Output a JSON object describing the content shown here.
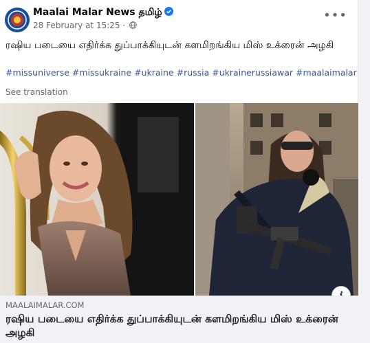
{
  "post": {
    "page_name": "Maalai Malar News தமிழ்",
    "timestamp": "28 February at 15:25",
    "separator": " · ",
    "more_label": "•••",
    "text": "ரஷிய படையை எதிர்க்க துப்பாக்கியுடன் களமிறங்கிய மிஸ் உக்ரைன் அழகி",
    "hashtags": [
      "#missuniverse",
      "#missukraine",
      "#ukraine",
      "#russia",
      "#ukrainerussiawar",
      "#maalaimalar"
    ],
    "see_translation": "See translation"
  },
  "link_preview": {
    "domain": "MAALAIMALAR.COM",
    "title": "ரஷிய படையை எதிர்க்க துப்பாக்கியுடன் களமிறங்கிய மிஸ் உக்ரைன் அழகி",
    "info_label": "i"
  },
  "colors": {
    "link_blue": "#385898",
    "verified_blue": "#1877f2",
    "muted_text": "#65676b",
    "avatar_blue": "#1a4e9a"
  },
  "icons": [
    "verified-badge-icon",
    "globe-icon",
    "more-options-icon",
    "info-icon"
  ]
}
